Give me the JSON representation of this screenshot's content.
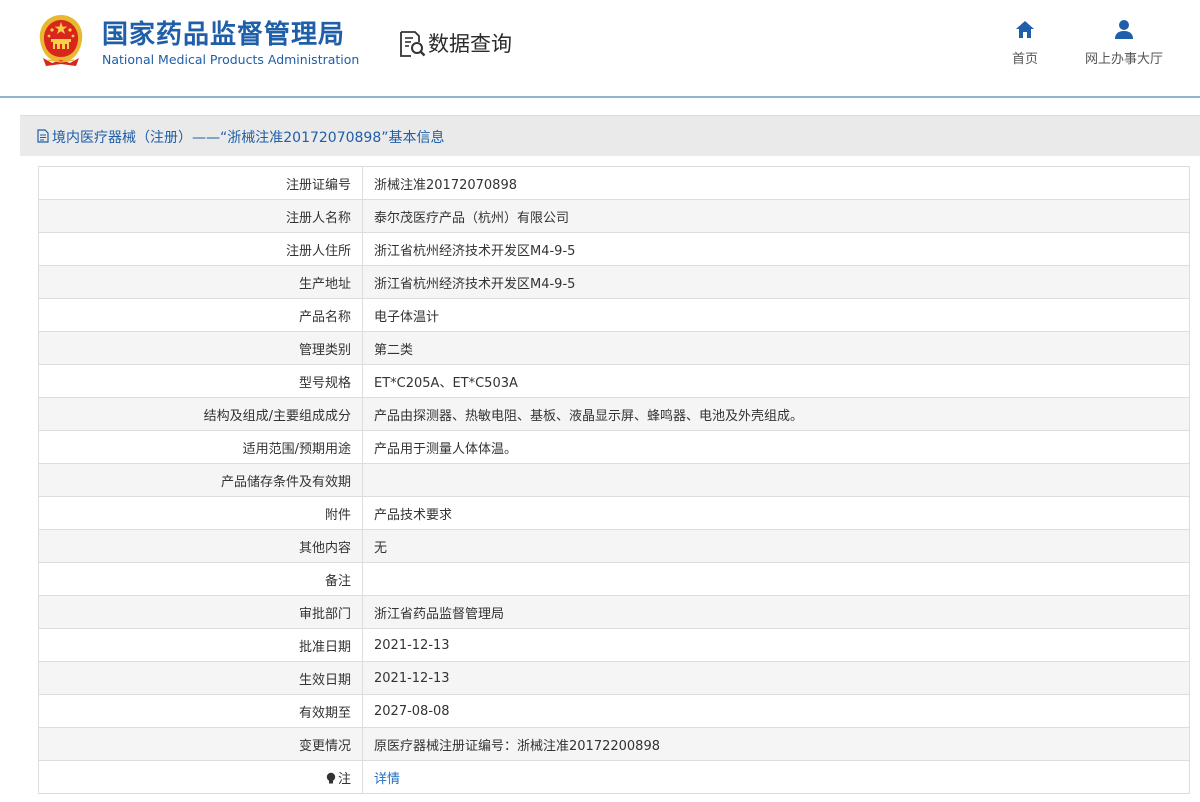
{
  "header": {
    "cn_title": "国家药品监督管理局",
    "en_title": "National Medical Products Administration",
    "query_title": "数据查询",
    "nav": {
      "home_label": "首页",
      "hall_label": "网上办事大厅"
    }
  },
  "panel": {
    "title": "境内医疗器械（注册）——“浙械注准20172070898”基本信息"
  },
  "records": [
    {
      "label": "注册证编号",
      "value": "浙械注准20172070898"
    },
    {
      "label": "注册人名称",
      "value": "泰尔茂医疗产品（杭州）有限公司"
    },
    {
      "label": "注册人住所",
      "value": "浙江省杭州经济技术开发区M4-9-5"
    },
    {
      "label": "生产地址",
      "value": "浙江省杭州经济技术开发区M4-9-5"
    },
    {
      "label": "产品名称",
      "value": "电子体温计"
    },
    {
      "label": "管理类别",
      "value": "第二类"
    },
    {
      "label": "型号规格",
      "value": "ET*C205A、ET*C503A"
    },
    {
      "label": "结构及组成/主要组成成分",
      "value": "产品由探测器、热敏电阻、基板、液晶显示屏、蜂鸣器、电池及外壳组成。"
    },
    {
      "label": "适用范围/预期用途",
      "value": "产品用于测量人体体温。"
    },
    {
      "label": "产品储存条件及有效期",
      "value": ""
    },
    {
      "label": "附件",
      "value": "产品技术要求"
    },
    {
      "label": "其他内容",
      "value": "无"
    },
    {
      "label": "备注",
      "value": ""
    },
    {
      "label": "审批部门",
      "value": "浙江省药品监督管理局"
    },
    {
      "label": "批准日期",
      "value": "2021-12-13"
    },
    {
      "label": "生效日期",
      "value": "2021-12-13"
    },
    {
      "label": "有效期至",
      "value": "2027-08-08"
    },
    {
      "label": "变更情况",
      "value": "原医疗器械注册证编号：浙械注准20172200898"
    }
  ],
  "note_row": {
    "label": "注",
    "link_label": "详情"
  },
  "icons": {
    "emblem": "national-emblem-icon",
    "query": "document-search-icon",
    "home": "home-icon",
    "hall": "user-icon",
    "doc": "document-icon",
    "note": "lightbulb-icon"
  },
  "colors": {
    "brand_blue": "#1f5ea8",
    "link_blue": "#1f6fc0",
    "header_rule": "#8fb4d4",
    "panel_bg": "#eaeaea"
  }
}
